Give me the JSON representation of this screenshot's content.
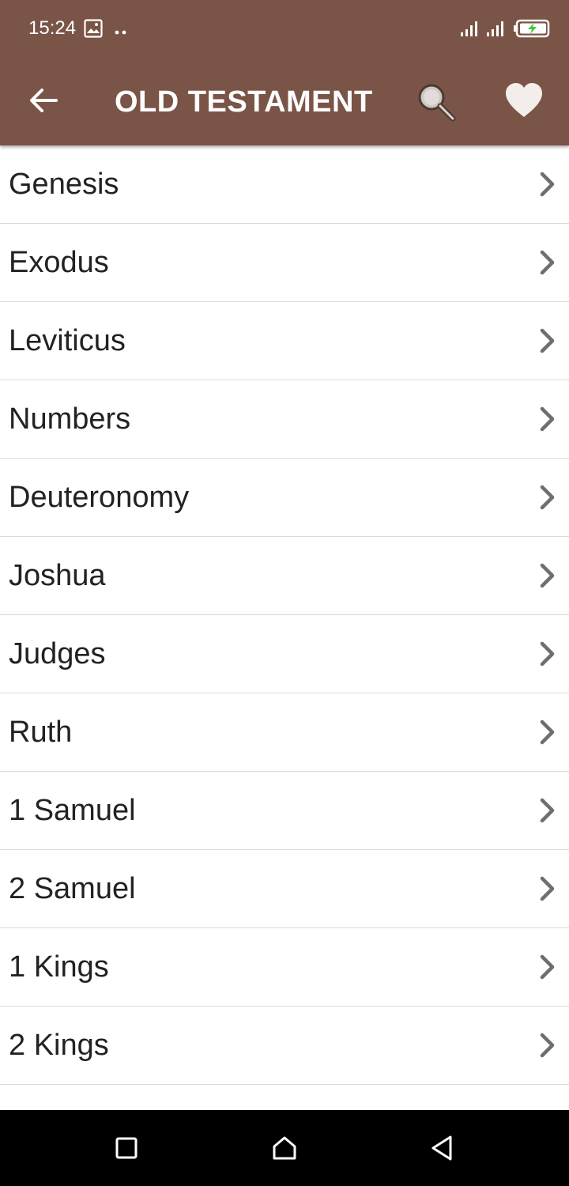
{
  "status_bar": {
    "time": "15:24"
  },
  "header": {
    "title": "OLD TESTAMENT",
    "bg_color": "#7a5446",
    "back_icon": "arrow-left-icon",
    "search_icon": "magnifier-icon",
    "favorite_icon": "heart-icon"
  },
  "books": [
    {
      "name": "Genesis"
    },
    {
      "name": "Exodus"
    },
    {
      "name": "Leviticus"
    },
    {
      "name": "Numbers"
    },
    {
      "name": "Deuteronomy"
    },
    {
      "name": "Joshua"
    },
    {
      "name": "Judges"
    },
    {
      "name": "Ruth"
    },
    {
      "name": "1 Samuel"
    },
    {
      "name": "2 Samuel"
    },
    {
      "name": "1 Kings"
    },
    {
      "name": "2 Kings"
    },
    {
      "name": ""
    }
  ],
  "nav_bar": {
    "recents_icon": "square-icon",
    "home_icon": "home-icon",
    "back_icon": "triangle-back-icon"
  }
}
